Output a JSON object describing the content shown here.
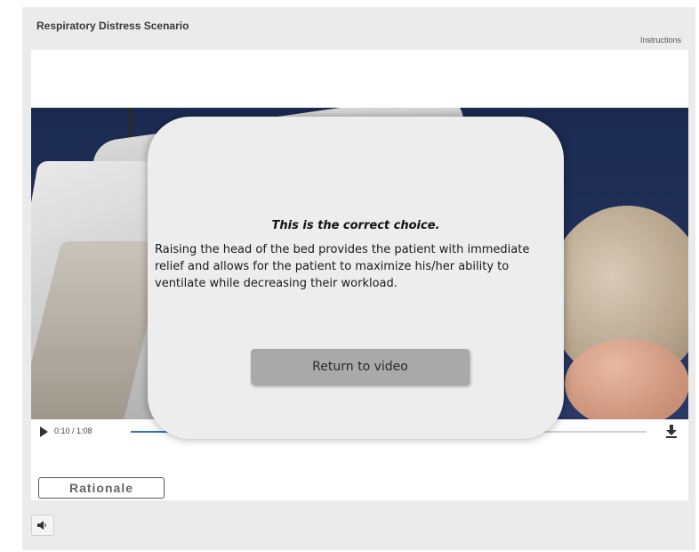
{
  "header": {
    "title": "Respiratory Distress Scenario",
    "instructions_label": "Instructions"
  },
  "video": {
    "time_display": "0:10 / 1:08",
    "progress_fraction": 0.147
  },
  "feedback": {
    "heading": "This is the correct choice.",
    "body": "Raising the head of the bed provides the patient with immediate relief and allows for the patient to maximize his/her ability to ventilate while decreasing their workload.",
    "return_label": "Return to video"
  },
  "footer": {
    "rationale_label": "Rationale"
  },
  "icons": {
    "play": "play-icon",
    "download": "download-icon",
    "speaker": "speaker-icon"
  },
  "colors": {
    "progress": "#2f74c7",
    "overlay": "#ededed",
    "return_button": "#a9a9a9"
  }
}
